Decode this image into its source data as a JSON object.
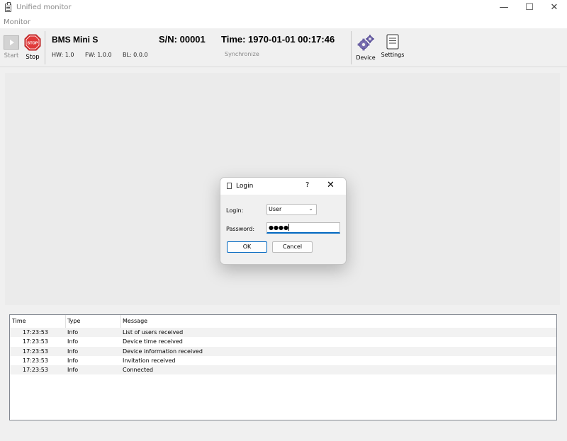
{
  "window": {
    "title": "Unified monitor",
    "minimize_glyph": "—",
    "maximize_glyph": "☐",
    "close_glyph": "✕"
  },
  "menu": {
    "items": [
      {
        "label": "Monitor"
      }
    ]
  },
  "toolbar": {
    "start_label": "Start",
    "stop_label": "Stop",
    "stop_icon_text": "STOP",
    "device_name": "BMS Mini S",
    "hw": "HW: 1.0",
    "fw": "FW: 1.0.0",
    "bl": "BL: 0.0.0",
    "serial": "S/N: 00001",
    "time": "Time: 1970-01-01 00:17:46",
    "synchronize_label": "Synchronize",
    "device_label": "Device",
    "settings_label": "Settings"
  },
  "dialog": {
    "title": "Login",
    "help_glyph": "?",
    "close_glyph": "✕",
    "login_label": "Login:",
    "login_value": "User",
    "password_label": "Password:",
    "password_value": "●●●●",
    "ok_label": "OK",
    "cancel_label": "Cancel"
  },
  "log": {
    "columns": [
      "Time",
      "Type",
      "Message"
    ],
    "rows": [
      {
        "time": "17:23:53",
        "type": "Info",
        "message": "List of users received"
      },
      {
        "time": "17:23:53",
        "type": "Info",
        "message": "Device time received"
      },
      {
        "time": "17:23:53",
        "type": "Info",
        "message": "Device information received"
      },
      {
        "time": "17:23:53",
        "type": "Info",
        "message": "Invitation received"
      },
      {
        "time": "17:23:53",
        "type": "Info",
        "message": "Connected"
      }
    ]
  },
  "colors": {
    "accent": "#0067c0",
    "stop_red": "#e03a3a",
    "gear_purple": "#7a6fb0"
  }
}
